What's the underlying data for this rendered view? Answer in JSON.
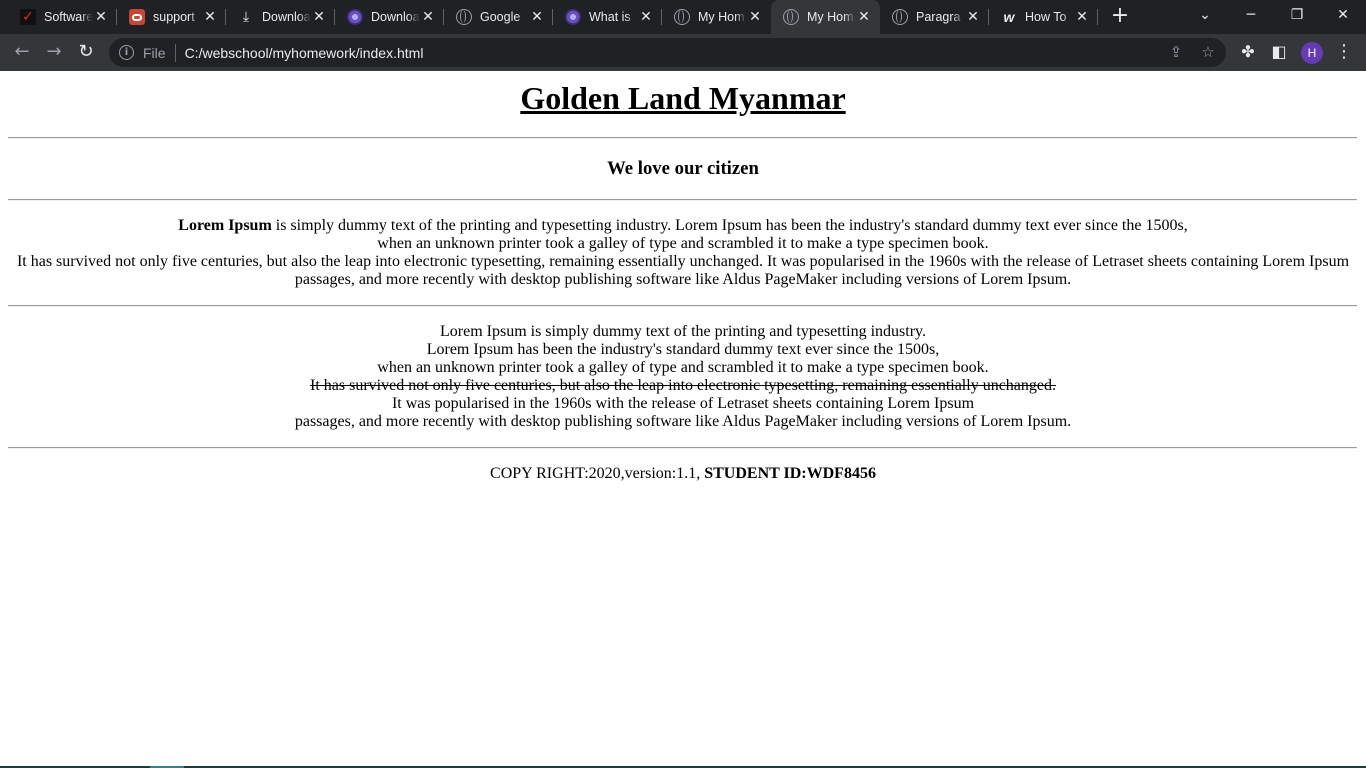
{
  "browser": {
    "tabs": [
      {
        "title": "Software",
        "icon": "v-logo-icon"
      },
      {
        "title": "support",
        "icon": "oracle-icon"
      },
      {
        "title": "Downloa",
        "icon": "download-icon"
      },
      {
        "title": "Downloa",
        "icon": "purple-logo-icon"
      },
      {
        "title": "Google",
        "icon": "globe-icon"
      },
      {
        "title": "What is",
        "icon": "purple-logo-icon"
      },
      {
        "title": "My Hom",
        "icon": "globe-icon"
      },
      {
        "title": "My Hom",
        "icon": "globe-icon",
        "active": true
      },
      {
        "title": "Paragra",
        "icon": "globe-icon"
      },
      {
        "title": "How To",
        "icon": "w-logo-icon"
      }
    ],
    "file_label": "File",
    "url": "C:/webschool/myhomework/index.html",
    "profile_initial": "H"
  },
  "page": {
    "title": "Golden Land Myanmar",
    "subtitle": "We love our citizen",
    "para1": {
      "bold": "Lorem Ipsum",
      "line1_rest": " is simply dummy text of the printing and typesetting industry. Lorem Ipsum has been the industry's standard dummy text ever since the 1500s,",
      "line2": "when an unknown printer took a galley of type and scrambled it to make a type specimen book.",
      "line3": "It has survived not only five centuries, but also the leap into electronic typesetting, remaining essentially unchanged. It was popularised in the 1960s with the release of Letraset sheets containing Lorem Ipsum passages, and more recently with desktop publishing software like Aldus PageMaker including versions of Lorem Ipsum."
    },
    "para2": {
      "line1": "Lorem Ipsum is simply dummy text of the printing and typesetting industry.",
      "line2": "Lorem Ipsum has been the industry's standard dummy text ever since the 1500s,",
      "line3": "when an unknown printer took a galley of type and scrambled it to make a type specimen book.",
      "line4_strike": "It has survived not only five centuries, but also the leap into electronic typesetting, remaining essentially unchanged.",
      "line5": "It was popularised in the 1960s with the release of Letraset sheets containing Lorem Ipsum",
      "line6": "passages, and more recently with desktop publishing software like Aldus PageMaker including versions of Lorem Ipsum."
    },
    "footer": {
      "text": "COPY RIGHT:2020,version:1.1, ",
      "bold": "STUDENT ID:WDF8456"
    }
  }
}
